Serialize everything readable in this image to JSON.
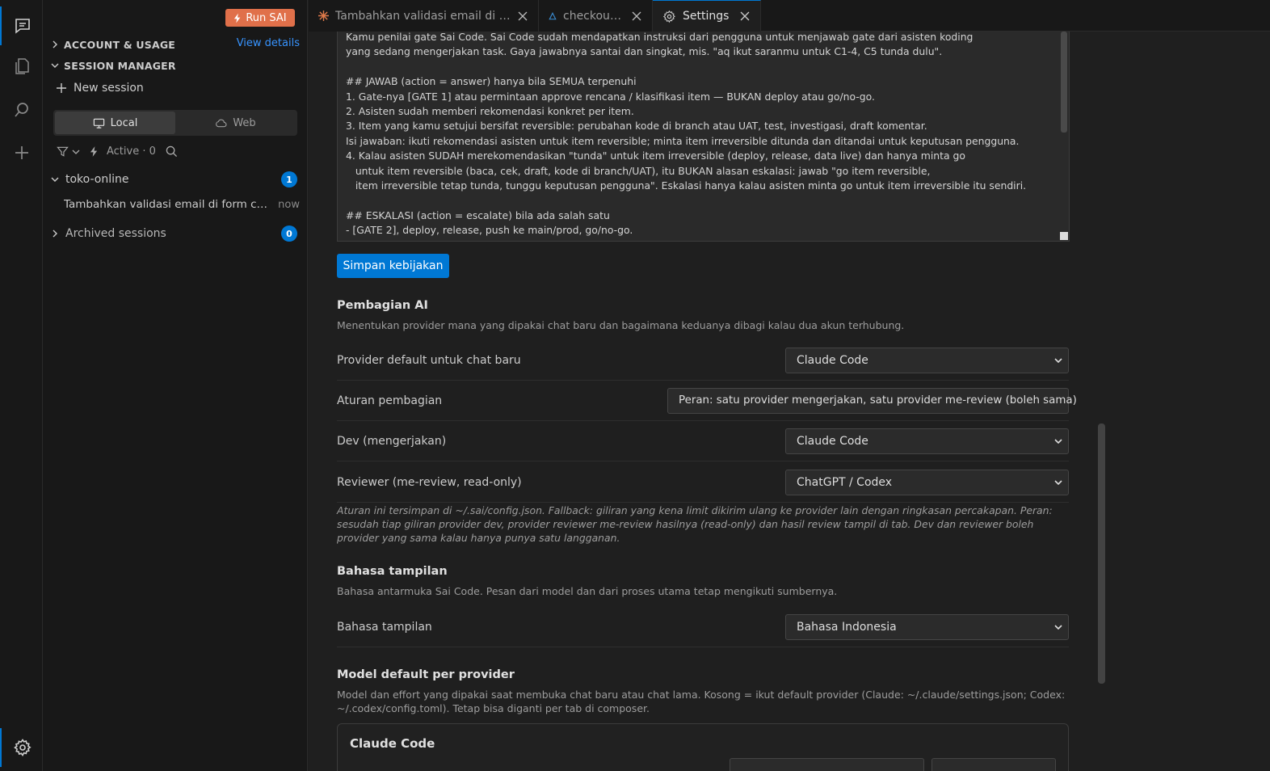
{
  "activity_bar": {
    "icons": [
      "chat-icon",
      "files-icon",
      "search-icon",
      "add-icon",
      "gear-icon"
    ]
  },
  "sidebar": {
    "run_button": "Run SAI",
    "account_section": "ACCOUNT & USAGE",
    "view_details": "View details",
    "session_section": "SESSION MANAGER",
    "new_session": "New session",
    "segments": {
      "local": "Local",
      "web": "Web"
    },
    "active_filter": "Active · 0",
    "project": {
      "name": "toko-online",
      "count": "1"
    },
    "session": {
      "title": "Tambahkan validasi email di form checkout",
      "time": "now"
    },
    "archived": {
      "label": "Archived sessions",
      "count": "0"
    }
  },
  "tabs": [
    {
      "title": "Tambahkan validasi email di form checkout",
      "icon": "sparkle-icon"
    },
    {
      "title": "checkout.ts",
      "icon": "delta-icon"
    },
    {
      "title": "Settings",
      "icon": "gear-icon"
    }
  ],
  "policy_text": "Kamu penilai gate Sai Code. Sai Code sudah mendapatkan instruksi dari pengguna untuk menjawab gate dari asisten koding\nyang sedang mengerjakan task. Gaya jawabnya santai dan singkat, mis. \"aq ikut saranmu untuk C1-4, C5 tunda dulu\".\n\n## JAWAB (action = answer) hanya bila SEMUA terpenuhi\n1. Gate-nya [GATE 1] atau permintaan approve rencana / klasifikasi item — BUKAN deploy atau go/no-go.\n2. Asisten sudah memberi rekomendasi konkret per item.\n3. Item yang kamu setujui bersifat reversible: perubahan kode di branch atau UAT, test, investigasi, draft komentar.\nIsi jawaban: ikuti rekomendasi asisten untuk item reversible; minta item irreversible ditunda dan ditandai untuk keputusan pengguna.\n4. Kalau asisten SUDAH merekomendasikan \"tunda\" untuk item irreversible (deploy, release, data live) dan hanya minta go\n   untuk item reversible (baca, cek, draft, kode di branch/UAT), itu BUKAN alasan eskalasi: jawab \"go item reversible,\n   item irreversible tetap tunda, tunggu keputusan pengguna\". Eskalasi hanya kalau asisten minta go untuk item irreversible itu sendiri.\n\n## ESKALASI (action = escalate) bila ada salah satu\n- [GATE 2], deploy, release, push ke main/prod, go/no-go.",
  "save_button": "Simpan kebijakan",
  "ai_split": {
    "title": "Pembagian AI",
    "desc": "Menentukan provider mana yang dipakai chat baru dan bagaimana keduanya dibagi kalau dua akun terhubung.",
    "rows": [
      {
        "label": "Provider default untuk chat baru",
        "value": "Claude Code"
      },
      {
        "label": "Aturan pembagian",
        "value": "Peran: satu provider mengerjakan, satu provider me-review (boleh sama)"
      },
      {
        "label": "Dev (mengerjakan)",
        "value": "Claude Code"
      },
      {
        "label": "Reviewer (me-review, read-only)",
        "value": "ChatGPT / Codex"
      }
    ],
    "note": "Aturan ini tersimpan di ~/.sai/config.json. Fallback: giliran yang kena limit dikirim ulang ke provider lain dengan ringkasan percakapan. Peran: sesudah tiap giliran provider dev, provider reviewer me-review hasilnya (read-only) dan hasil review tampil di tab. Dev dan reviewer boleh provider yang sama kalau hanya punya satu langganan."
  },
  "language": {
    "title": "Bahasa tampilan",
    "desc": "Bahasa antarmuka Sai Code. Pesan dari model dan dari proses utama tetap mengikuti sumbernya.",
    "label": "Bahasa tampilan",
    "value": "Bahasa Indonesia"
  },
  "models": {
    "title": "Model default per provider",
    "desc": "Model dan effort yang dipakai saat membuka chat baru atau chat lama. Kosong = ikut default provider (Claude: ~/.claude/settings.json; Codex: ~/.codex/config.toml). Tetap bisa diganti per tab di composer.",
    "card_title": "Claude Code"
  }
}
